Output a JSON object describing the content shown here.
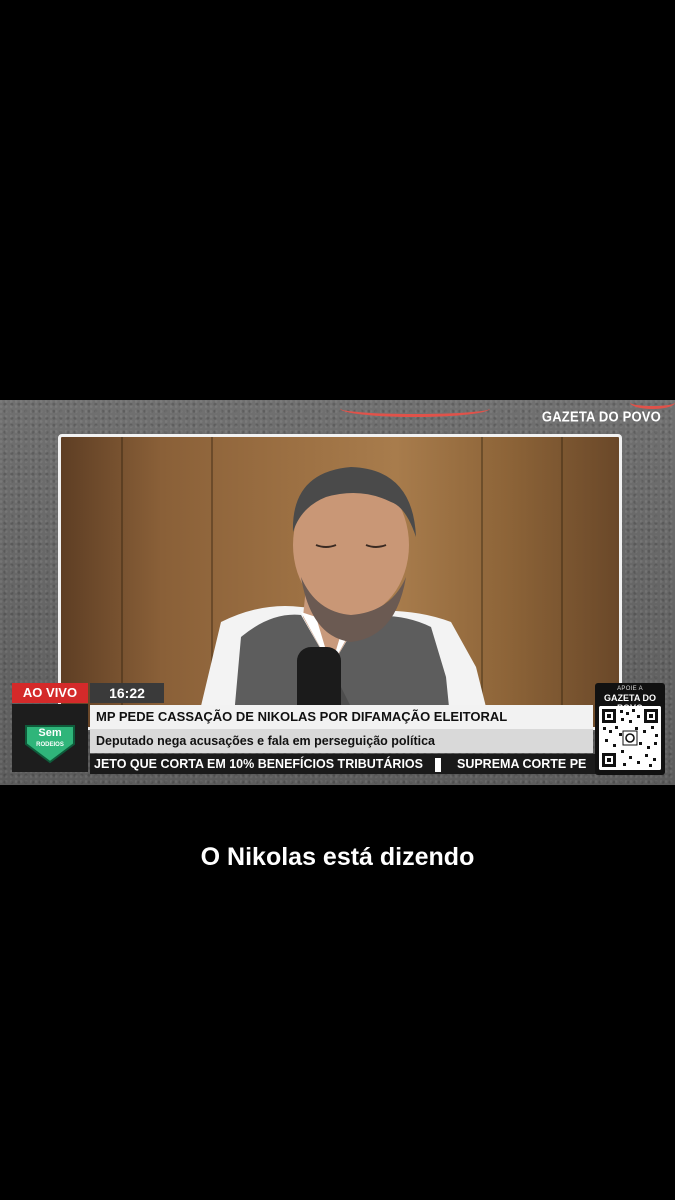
{
  "brand": "GAZETA DO POVO",
  "live_label": "AO VIVO",
  "time": "16:22",
  "logo_text_1": "Sem",
  "logo_text_2": "RODEIOS",
  "headline": "MP PEDE CASSAÇÃO DE NIKOLAS POR DIFAMAÇÃO ELEITORAL",
  "subheadline": "Deputado nega acusações e fala em perseguição política",
  "ticker_items": [
    "JETO QUE CORTA EM 10% BENEFÍCIOS TRIBUTÁRIOS",
    "SUPREMA CORTE PE"
  ],
  "qr_caption_top": "APOIE A",
  "qr_caption_brand": "GAZETA DO POVO",
  "caption": "O Nikolas está dizendo",
  "colors": {
    "live_red": "#d42a2a",
    "logo_green": "#2fb57a"
  }
}
